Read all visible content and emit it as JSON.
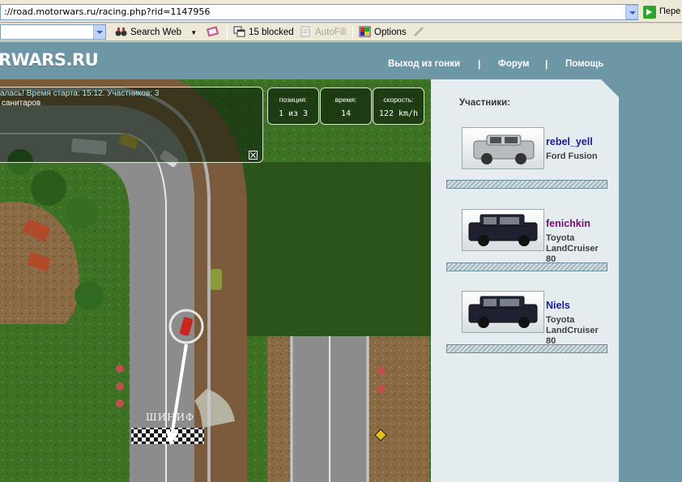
{
  "browser": {
    "address": "://road.motorwars.ru/racing.php?rid=1147956",
    "go_label": "Пере",
    "toolbar": {
      "search_web": "Search Web",
      "blocked": "15 blocked",
      "autofill": "AutoFill",
      "options": "Options"
    }
  },
  "site": {
    "logo": "RWARS.RU",
    "nav": [
      "Выход из гонки",
      "Форум",
      "Помощь"
    ],
    "nav_sep": "|"
  },
  "race": {
    "message": "алась! Время старта: 15:12. Участников: 3",
    "message2": "санитаров",
    "stats": [
      {
        "label": "позиция:",
        "value": "1 из 3"
      },
      {
        "label": "время:",
        "value": "14"
      },
      {
        "label": "скорость:",
        "value": "122 km/h"
      }
    ],
    "finish_label": "ШИНИФ"
  },
  "participants": {
    "title": "Участники:",
    "players": [
      {
        "name": "rebel_yell",
        "car": "Ford Fusion",
        "name_color": "#1a1a99"
      },
      {
        "name": "fenichkin",
        "car": "Toyota LandCruiser 80",
        "name_color": "#7a0c7a"
      },
      {
        "name": "Niels",
        "car": "Toyota LandCruiser 80",
        "name_color": "#1a1a99"
      }
    ]
  }
}
